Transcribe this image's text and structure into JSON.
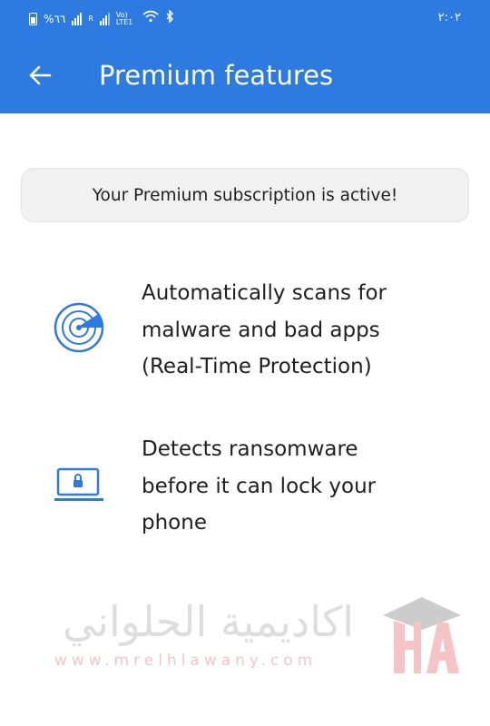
{
  "status_bar": {
    "battery_text": "%٦٦",
    "network_label": "R",
    "volte_label": "Vo) LTE1",
    "time": "٢:٠٢"
  },
  "app_bar": {
    "back_icon": "arrow-left-icon",
    "title": "Premium features"
  },
  "banner": {
    "text": "Your Premium subscription is active!"
  },
  "features": [
    {
      "icon": "radar-scan-icon",
      "lines": [
        "Automatically scans for",
        "malware and bad apps",
        "(Real-Time Protection)"
      ]
    },
    {
      "icon": "laptop-lock-icon",
      "lines": [
        "Detects ransomware",
        "before it can lock your",
        "phone"
      ]
    }
  ],
  "watermark": {
    "arabic": "اكاديمية الحلواني",
    "url": "www.mrelhlawany.com",
    "logo_letters": "HA"
  },
  "colors": {
    "primary": "#2d7ae0",
    "icon_blue": "#2d7ae0",
    "banner_bg": "#f1f1f1",
    "text": "#1f1f1f"
  }
}
